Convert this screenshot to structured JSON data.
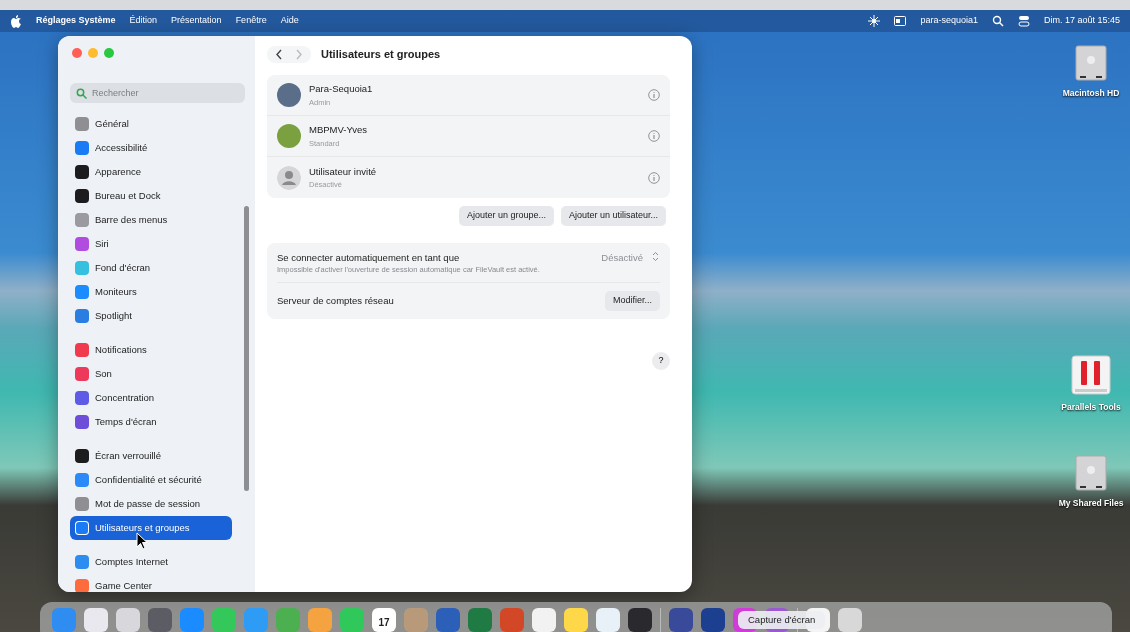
{
  "menubar": {
    "app": "Réglages Système",
    "menus": [
      "Édition",
      "Présentation",
      "Fenêtre",
      "Aide"
    ],
    "user": "para-sequoia1",
    "clock": "Dim. 17 août 15:45"
  },
  "window": {
    "search": {
      "placeholder": "Rechercher"
    },
    "sidebar": [
      [
        {
          "label": "Général",
          "color": "#8e8e93",
          "selected": false
        },
        {
          "label": "Accessibilité",
          "color": "#1a7cf5",
          "selected": false
        },
        {
          "label": "Apparence",
          "color": "#1c1c1e",
          "selected": false
        },
        {
          "label": "Bureau et Dock",
          "color": "#1c1c1e",
          "selected": false
        },
        {
          "label": "Barre des menus",
          "color": "#9a9aa0",
          "selected": false
        },
        {
          "label": "Siri",
          "color": "#b04de0",
          "selected": false
        },
        {
          "label": "Fond d'écran",
          "color": "#35c0e0",
          "selected": false
        },
        {
          "label": "Moniteurs",
          "color": "#1a8cff",
          "selected": false
        },
        {
          "label": "Spotlight",
          "color": "#2a7de1",
          "selected": false
        }
      ],
      [
        {
          "label": "Notifications",
          "color": "#ef3b4d",
          "selected": false
        },
        {
          "label": "Son",
          "color": "#ee3a5a",
          "selected": false
        },
        {
          "label": "Concentration",
          "color": "#5e5ce6",
          "selected": false
        },
        {
          "label": "Temps d'écran",
          "color": "#6e4ed8",
          "selected": false
        }
      ],
      [
        {
          "label": "Écran verrouillé",
          "color": "#1c1c1e",
          "selected": false
        },
        {
          "label": "Confidentialité et sécurité",
          "color": "#2b8af7",
          "selected": false
        },
        {
          "label": "Mot de passe de session",
          "color": "#8e8e93",
          "selected": false
        },
        {
          "label": "Utilisateurs et groupes",
          "color": "#1a7cf5",
          "selected": true
        }
      ],
      [
        {
          "label": "Comptes Internet",
          "color": "#2d8cf0",
          "selected": false
        },
        {
          "label": "Game Center",
          "color": "#ff6b3d",
          "selected": false
        }
      ]
    ],
    "title": "Utilisateurs et groupes",
    "users": [
      {
        "name": "Para-Sequoia1",
        "role": "Admin",
        "kind": "photo"
      },
      {
        "name": "MBPMV-Yves",
        "role": "Standard",
        "kind": "photo"
      },
      {
        "name": "Utilisateur invité",
        "role": "Désactivé",
        "kind": "generic"
      }
    ],
    "buttons": [
      "Ajouter un groupe...",
      "Ajouter un utilisateur..."
    ],
    "autologin": {
      "label": "Se connecter automatiquement en tant que",
      "note": "Impossible d'activer l'ouverture de session automatique car FileVault est activé.",
      "value": "Désactivé",
      "disabled": true
    },
    "network": {
      "label": "Serveur de comptes réseau",
      "button": "Modifier..."
    },
    "help": "?"
  },
  "desktop_icons": [
    {
      "label": "Macintosh HD",
      "kind": "disk"
    },
    {
      "label": "Parallels Tools",
      "kind": "parallels"
    },
    {
      "label": "My Shared Files",
      "kind": "disk"
    }
  ],
  "dock": {
    "tooltip": "Capture d'écran",
    "items": [
      {
        "kind": "app",
        "color": "#2f8cf0"
      },
      {
        "kind": "app",
        "color": "#e8e8ee"
      },
      {
        "kind": "app",
        "color": "#d8d8dc"
      },
      {
        "kind": "app",
        "color": "#5c5c64"
      },
      {
        "kind": "app",
        "color": "#1a8cff"
      },
      {
        "kind": "app",
        "color": "#34c759"
      },
      {
        "kind": "app",
        "color": "#2e9bf5"
      },
      {
        "kind": "app",
        "color": "#4caf50"
      },
      {
        "kind": "app",
        "color": "#f4a340"
      },
      {
        "kind": "app",
        "color": "#30c85a"
      },
      {
        "kind": "calendar",
        "color": "#ffffff",
        "date": "17"
      },
      {
        "kind": "app",
        "color": "#b89a7a"
      },
      {
        "kind": "app",
        "color": "#2b5fb8"
      },
      {
        "kind": "app",
        "color": "#1f7a44"
      },
      {
        "kind": "app",
        "color": "#d24726"
      },
      {
        "kind": "app",
        "color": "#f2f2f2"
      },
      {
        "kind": "app",
        "color": "#ffd84a"
      },
      {
        "kind": "app",
        "color": "#e8f0f8"
      },
      {
        "kind": "app",
        "color": "#2a2a2e"
      },
      {
        "kind": "sep"
      },
      {
        "kind": "app",
        "color": "#3a4a9a"
      },
      {
        "kind": "app",
        "color": "#1c3f8f"
      },
      {
        "kind": "app",
        "color": "#d03cd8"
      },
      {
        "kind": "app",
        "color": "#9b59d0"
      },
      {
        "kind": "sep"
      },
      {
        "kind": "app",
        "color": "#f4f4f4"
      },
      {
        "kind": "app",
        "color": "#d8d8d8"
      }
    ]
  }
}
